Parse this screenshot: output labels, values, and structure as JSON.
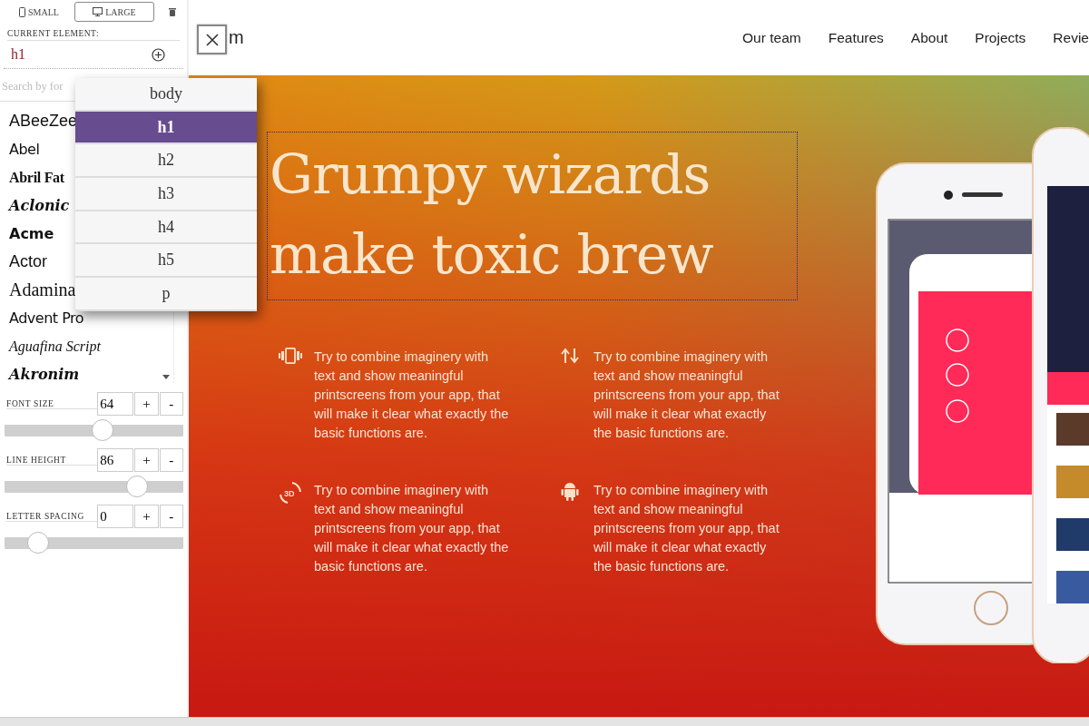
{
  "editor": {
    "devices": [
      {
        "label": "SMALL",
        "kind": "phone",
        "selected": false
      },
      {
        "label": "LARGE",
        "kind": "desktop",
        "selected": true
      }
    ],
    "current_element_label": "CURRENT ELEMENT:",
    "current_element": "h1",
    "search": {
      "placeholder": "Search by for"
    },
    "fonts": [
      {
        "label": "ABeeZee",
        "kind": "sans"
      },
      {
        "label": "Abel",
        "kind": "narrow"
      },
      {
        "label": "Abril Fat",
        "kind": "bold-serif"
      },
      {
        "label": "Aclonic",
        "kind": "blackletter"
      },
      {
        "label": "Acme",
        "kind": "bold-sans"
      },
      {
        "label": "Actor",
        "kind": "sans"
      },
      {
        "label": "Adamina",
        "kind": "serif"
      },
      {
        "label": "Advent Pro",
        "kind": "narrow"
      },
      {
        "label": "Aguafina Script",
        "kind": "script"
      },
      {
        "label": "Akronim",
        "kind": "blackletter"
      }
    ],
    "controls": [
      {
        "label": "FONT SIZE",
        "value": "64",
        "level": 0.55
      },
      {
        "label": "LINE HEIGHT",
        "value": "86",
        "level": 0.74
      },
      {
        "label": "LETTER SPACING",
        "value": "0",
        "level": 0.19
      }
    ],
    "increment": "+",
    "decrement": "-",
    "element_menu": [
      {
        "label": "body",
        "selected": false
      },
      {
        "label": "h1",
        "selected": true
      },
      {
        "label": "h2",
        "selected": false
      },
      {
        "label": "h3",
        "selected": false
      },
      {
        "label": "h4",
        "selected": false
      },
      {
        "label": "h5",
        "selected": false
      },
      {
        "label": "p",
        "selected": false
      }
    ]
  },
  "header": {
    "logo": "m",
    "nav": [
      "Our team",
      "Features",
      "About",
      "Projects",
      "Revie"
    ]
  },
  "hero": {
    "title": "Grumpy wizards make toxic brew",
    "features": [
      {
        "kind": "vibrate",
        "text": "Try to combine imaginery with text and show meaningful printscreens from your app, that will make it clear what exactly the basic functions are."
      },
      {
        "kind": "swap",
        "text": "Try to combine imaginery with text and show meaningful printscreens from your app, that will make it clear what exactly the basic functions are."
      },
      {
        "kind": "rotate-3d",
        "icon_label": "3D",
        "text": "Try to combine imaginery with text and show meaningful printscreens from your app, that will make it clear what exactly the basic functions are."
      },
      {
        "kind": "android",
        "text": "Try to combine imaginery with text and show meaningful printscreens from your app, that will make it clear what exactly the basic functions are."
      }
    ]
  }
}
